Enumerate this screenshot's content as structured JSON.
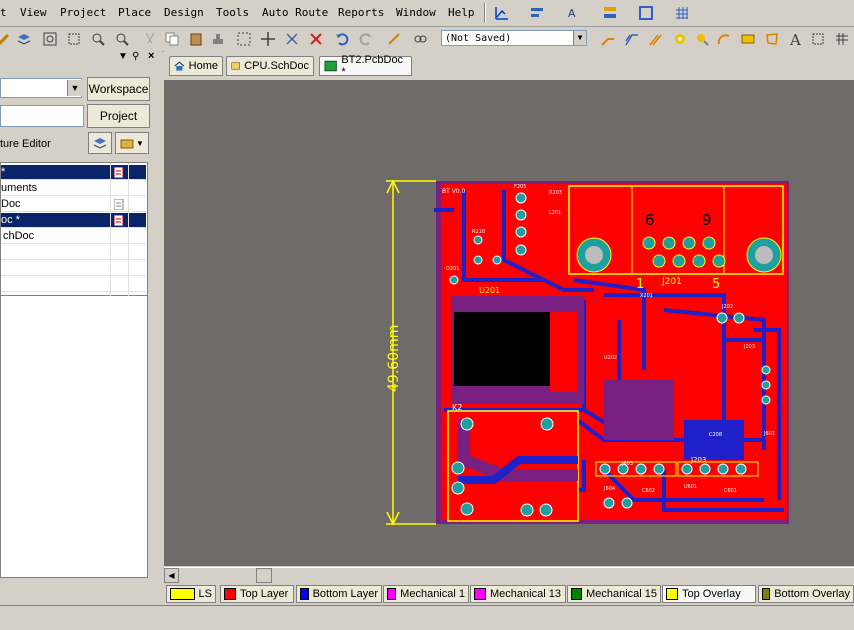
{
  "menu": {
    "items": [
      "t",
      "View",
      "Project",
      "Place",
      "Design",
      "Tools",
      "Auto Route",
      "Reports",
      "Window",
      "Help"
    ]
  },
  "toolbar": {
    "view_state": "(Not Saved)"
  },
  "left_panel": {
    "workspace_button": "Workspace",
    "project_button": "Project",
    "editor_label": "ture Editor",
    "tree_rows": [
      "*",
      "uments",
      "Doc",
      "oc *",
      "chDoc"
    ]
  },
  "doc_tabs": [
    "Home",
    "CPU.SchDoc",
    "BT2.PcbDoc *"
  ],
  "pcb": {
    "dimension": "49.60mm",
    "board_label": "BT V0.0",
    "connector_labels": [
      "6",
      "9",
      "1",
      "5"
    ],
    "component_labels": [
      "J201",
      "U201",
      "K2",
      "J203",
      "J201"
    ],
    "colors": {
      "background": "#6e6b68",
      "top_copper": "#ff0000",
      "bottom_copper": "#2020c8",
      "overlay": "#ffff00",
      "pad": "#1fa0a0"
    }
  },
  "layer_tabs": [
    {
      "label": "LS",
      "color": "#ffff00"
    },
    {
      "label": "Top Layer",
      "color": "#ff0000"
    },
    {
      "label": "Bottom Layer",
      "color": "#0000ff"
    },
    {
      "label": "Mechanical 1",
      "color": "#ff00ff"
    },
    {
      "label": "Mechanical 13",
      "color": "#ff00ff"
    },
    {
      "label": "Mechanical 15",
      "color": "#008000"
    },
    {
      "label": "Top Overlay",
      "color": "#ffff00"
    },
    {
      "label": "Bottom Overlay",
      "color": "#808000"
    }
  ]
}
